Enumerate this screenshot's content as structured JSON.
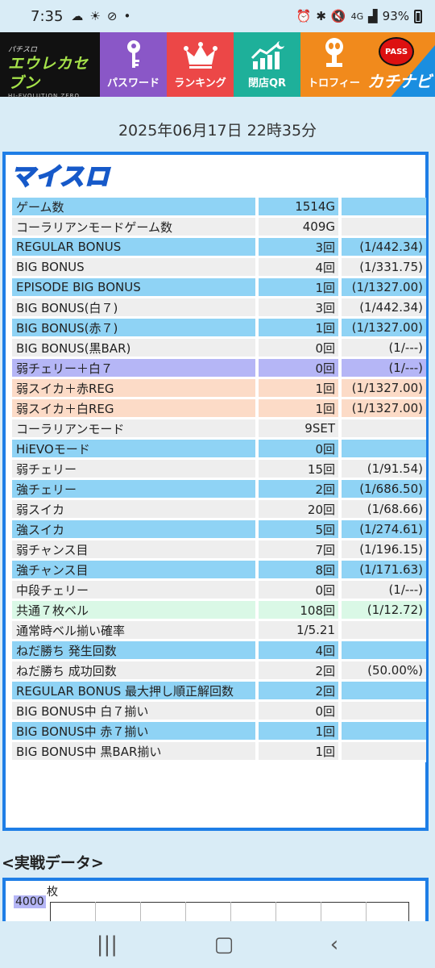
{
  "status": {
    "time": "7:35",
    "battery": "93%",
    "net": "4G"
  },
  "header": {
    "logo_small": "パチスロ",
    "logo_main": "エウレカセブン",
    "logo_sub": "HI-EVOLUTION ZERO",
    "nav": [
      {
        "label": "パスワード",
        "icon": "key-icon"
      },
      {
        "label": "ランキング",
        "icon": "crown-icon"
      },
      {
        "label": "閉店QR",
        "icon": "chart-moon-icon"
      },
      {
        "label": "トロフィー",
        "icon": "trophy-icon"
      }
    ],
    "kachinavi_badge": "PASS",
    "kachinavi_text": "カチナビ"
  },
  "date": "2025年06月17日 22時35分",
  "panel": {
    "logo": "マイスロ",
    "rows": [
      {
        "label": "ゲーム数",
        "value": "1514G",
        "rate": "",
        "color": "blue"
      },
      {
        "label": "コーラリアンモードゲーム数",
        "value": "409G",
        "rate": "",
        "color": "grey"
      },
      {
        "label": "REGULAR BONUS",
        "value": "3回",
        "rate": "(1/442.34)",
        "color": "blue"
      },
      {
        "label": "BIG BONUS",
        "value": "4回",
        "rate": "(1/331.75)",
        "color": "grey"
      },
      {
        "label": "EPISODE BIG BONUS",
        "value": "1回",
        "rate": "(1/1327.00)",
        "color": "blue"
      },
      {
        "label": "BIG BONUS(白７)",
        "value": "3回",
        "rate": "(1/442.34)",
        "color": "grey"
      },
      {
        "label": "BIG BONUS(赤７)",
        "value": "1回",
        "rate": "(1/1327.00)",
        "color": "blue"
      },
      {
        "label": "BIG BONUS(黒BAR)",
        "value": "0回",
        "rate": "(1/---)",
        "color": "grey"
      },
      {
        "label": "弱チェリー＋白７",
        "value": "0回",
        "rate": "(1/---)",
        "color": "purple"
      },
      {
        "label": "弱スイカ＋赤REG",
        "value": "1回",
        "rate": "(1/1327.00)",
        "color": "peach"
      },
      {
        "label": "弱スイカ＋白REG",
        "value": "1回",
        "rate": "(1/1327.00)",
        "color": "peach"
      },
      {
        "label": "コーラリアンモード",
        "value": "9SET",
        "rate": "",
        "color": "grey"
      },
      {
        "label": "HiEVOモード",
        "value": "0回",
        "rate": "",
        "color": "blue"
      },
      {
        "label": "弱チェリー",
        "value": "15回",
        "rate": "(1/91.54)",
        "color": "grey"
      },
      {
        "label": "強チェリー",
        "value": "2回",
        "rate": "(1/686.50)",
        "color": "blue"
      },
      {
        "label": "弱スイカ",
        "value": "20回",
        "rate": "(1/68.66)",
        "color": "grey"
      },
      {
        "label": "強スイカ",
        "value": "5回",
        "rate": "(1/274.61)",
        "color": "blue"
      },
      {
        "label": "弱チャンス目",
        "value": "7回",
        "rate": "(1/196.15)",
        "color": "grey"
      },
      {
        "label": "強チャンス目",
        "value": "8回",
        "rate": "(1/171.63)",
        "color": "blue"
      },
      {
        "label": "中段チェリー",
        "value": "0回",
        "rate": "(1/---)",
        "color": "grey"
      },
      {
        "label": "共通７枚ベル",
        "value": "108回",
        "rate": "(1/12.72)",
        "color": "mint"
      },
      {
        "label": "通常時ベル揃い確率",
        "value": "1/5.21",
        "rate": "",
        "color": "grey"
      },
      {
        "label": "ねだ勝ち 発生回数",
        "value": "4回",
        "rate": "",
        "color": "blue"
      },
      {
        "label": "ねだ勝ち 成功回数",
        "value": "2回",
        "rate": "(50.00%)",
        "color": "grey"
      },
      {
        "label": "REGULAR BONUS 最大押し順正解回数",
        "value": "2回",
        "rate": "",
        "color": "blue"
      },
      {
        "label": "BIG BONUS中 白７揃い",
        "value": "0回",
        "rate": "",
        "color": "grey"
      },
      {
        "label": "BIG BONUS中 赤７揃い",
        "value": "1回",
        "rate": "",
        "color": "blue"
      },
      {
        "label": "BIG BONUS中 黒BAR揃い",
        "value": "1回",
        "rate": "",
        "color": "grey"
      }
    ]
  },
  "section": {
    "title": "<実戦データ>",
    "chart_unit": "枚",
    "chart_ytick": "4000"
  },
  "colors": {
    "accent": "#1e7ee6",
    "blue": "#8fd3f5",
    "grey": "#eeeeee",
    "purple": "#b5b6f6",
    "peach": "#fcdbc7",
    "mint": "#daf8e6"
  }
}
